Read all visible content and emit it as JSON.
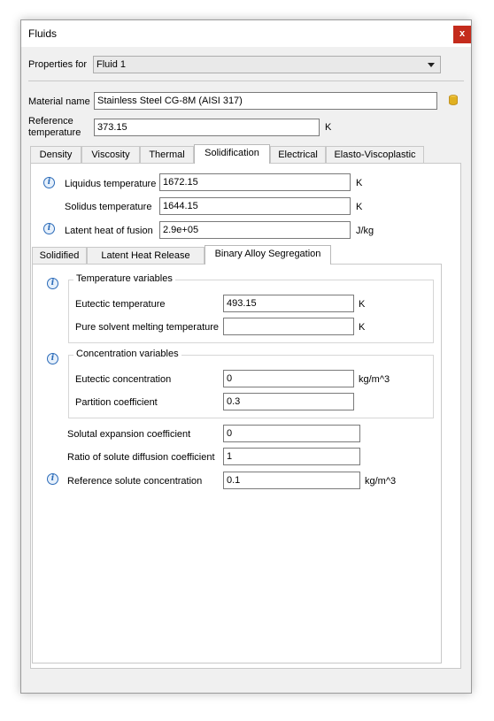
{
  "window": {
    "title": "Fluids",
    "close_glyph": "x"
  },
  "properties_for": {
    "label": "Properties for",
    "selected": "Fluid 1"
  },
  "material": {
    "label": "Material name",
    "value": "Stainless Steel CG-8M (AISI 317)",
    "icon": "database-icon"
  },
  "reference_temperature": {
    "label_line1": "Reference",
    "label_line2": "temperature",
    "value": "373.15",
    "unit": "K"
  },
  "tabs": [
    {
      "label": "Density"
    },
    {
      "label": "Viscosity"
    },
    {
      "label": "Thermal"
    },
    {
      "label": "Solidification",
      "active": true
    },
    {
      "label": "Electrical"
    },
    {
      "label": "Elasto-Viscoplastic"
    }
  ],
  "solidification": {
    "liquidus": {
      "label": "Liquidus temperature",
      "value": "1672.15",
      "unit": "K"
    },
    "solidus": {
      "label": "Solidus temperature",
      "value": "1644.15",
      "unit": "K"
    },
    "latent_heat": {
      "label": "Latent heat of fusion",
      "value": "2.9e+05",
      "unit": "J/kg"
    }
  },
  "subtabs": [
    {
      "label": "Solidified"
    },
    {
      "label": "Latent Heat Release"
    },
    {
      "label": "Binary Alloy Segregation",
      "active": true
    }
  ],
  "binary_alloy": {
    "temperature_group": {
      "title": "Temperature variables",
      "eutectic_temperature": {
        "label": "Eutectic temperature",
        "value": "493.15",
        "unit": "K"
      },
      "pure_solvent": {
        "label": "Pure solvent melting temperature",
        "value": "",
        "unit": "K"
      }
    },
    "concentration_group": {
      "title": "Concentration variables",
      "eutectic_concentration": {
        "label": "Eutectic concentration",
        "value": "0",
        "unit": "kg/m^3"
      },
      "partition_coefficient": {
        "label": "Partition coefficient",
        "value": "0.3"
      }
    },
    "solutal_expansion": {
      "label": "Solutal expansion coefficient",
      "value": "0"
    },
    "solute_diffusion_ratio": {
      "label": "Ratio of solute diffusion coefficient",
      "value": "1"
    },
    "reference_solute": {
      "label": "Reference solute concentration",
      "value": "0.1",
      "unit": "kg/m^3"
    }
  },
  "colors": {
    "close_button": "#c42b1c",
    "info_icon": "#2a6ab8",
    "database_icon": "#e0b020"
  }
}
